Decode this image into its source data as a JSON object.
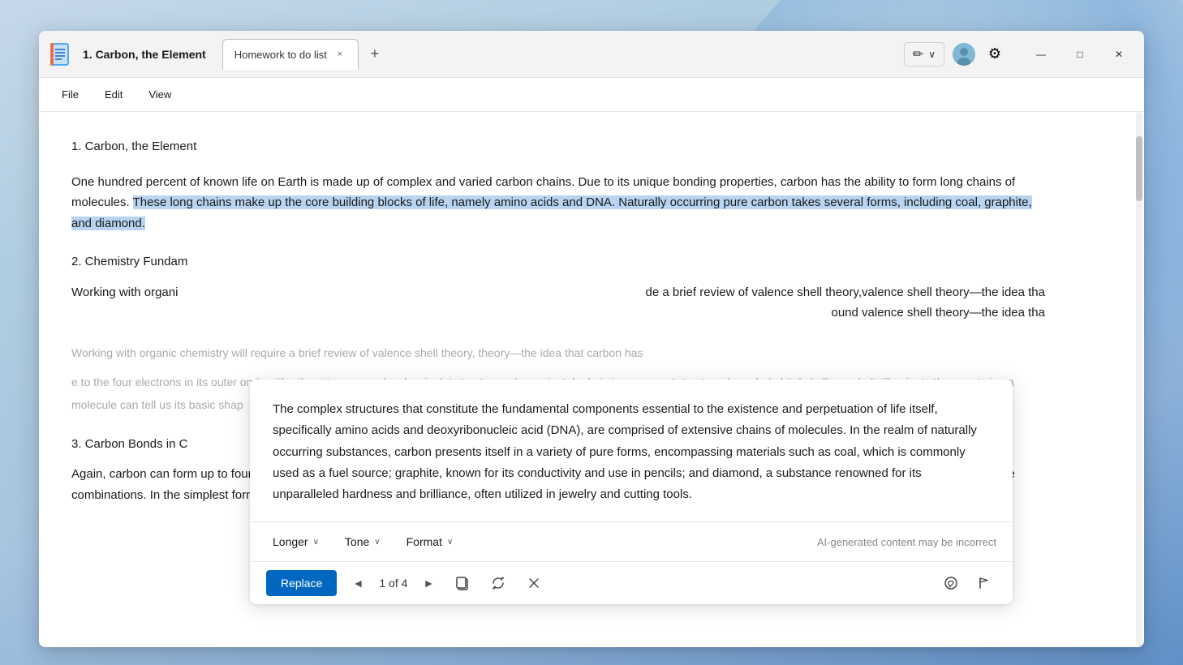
{
  "window": {
    "title": "1. Carbon, the Element",
    "minimize_label": "—",
    "maximize_label": "□",
    "close_label": "✕"
  },
  "tabs": [
    {
      "label": "Homework to do list",
      "active": false,
      "close": "×"
    }
  ],
  "tab_add": "+",
  "menu": {
    "items": [
      "File",
      "Edit",
      "View"
    ],
    "copilot_label": "✏",
    "copilot_chevron": "∨"
  },
  "document": {
    "heading": "1. Carbon, the Element",
    "paragraph1_before": "One hundred percent of known life on Earth is made up of complex and varied carbon chains. Due to its unique bonding properties, carbon has the ability to form long chains of molecules. ",
    "paragraph1_highlighted": "These long chains make up the core building blocks of life, namely amino acids and DNA. Naturally occurring pure carbon takes several forms, including coal, graphite, and diamond.",
    "paragraph1_highlighted_end": "",
    "subheading2": "2. Chemistry Fundam",
    "paragraph2_start": "Working with organi",
    "paragraph2_mid": "de a brief review of valence shell theory,",
    "paragraph2_mid2": "ound valence shell theory—the idea tha",
    "paragraph2_mid3": "e to the four electrons in its oute",
    "paragraph2_mid4": "onds with other atoms or molecules.",
    "paragraph2_mid5": "is dot structures play a pivotal role in",
    "paragraph2_mid6": "ing resonant structures) can help",
    "paragraph2_mid7": "bital shells can help illuminate the eventu",
    "paragraph2_mid8": "ise a molecule can tell us its basic shap",
    "subheading3": "3. Carbon Bonds in C",
    "paragraph3": "Again, carbon can form up to four bonds with other molecules. In organic chemistry, we mainly focus on carbon chains with hydrogen and oxygen, but there are infinite possible combinations. In the simplest form, carbon bonds with four hydrogen in single bonds. In other instances"
  },
  "rewrite_popup": {
    "content": "The complex structures that constitute the fundamental components essential to the existence and perpetuation of life itself, specifically amino acids and deoxyribonucleic acid (DNA), are comprised of extensive chains of molecules. In the realm of naturally occurring substances, carbon presents itself in a variety of pure forms, encompassing materials such as coal, which is commonly used as a fuel source; graphite, known for its conductivity and use in pencils; and diamond, a substance renowned for its unparalleled hardness and brilliance, often utilized in jewelry and cutting tools.",
    "toolbar": {
      "longer_label": "Longer",
      "tone_label": "Tone",
      "format_label": "Format",
      "chevron": "∨",
      "ai_disclaimer": "AI-generated content may be incorrect"
    },
    "actions": {
      "replace_label": "Replace",
      "prev": "◄",
      "counter": "1 of 4",
      "next": "►",
      "copy_icon": "copy",
      "refresh_icon": "refresh",
      "close_icon": "✕"
    }
  },
  "icons": {
    "app": "📋",
    "copilot": "✏",
    "settings": "⚙",
    "copy": "⧉",
    "refresh": "↻",
    "close": "✕",
    "flag": "⚑",
    "message": "💬",
    "minimize": "—",
    "maximize": "□",
    "chevron_down": "⌄"
  },
  "colors": {
    "accent_blue": "#0067c0",
    "highlight_blue": "#b8d4f0",
    "title_bar_bg": "#f3f3f3",
    "menu_bar_bg": "#ffffff"
  }
}
